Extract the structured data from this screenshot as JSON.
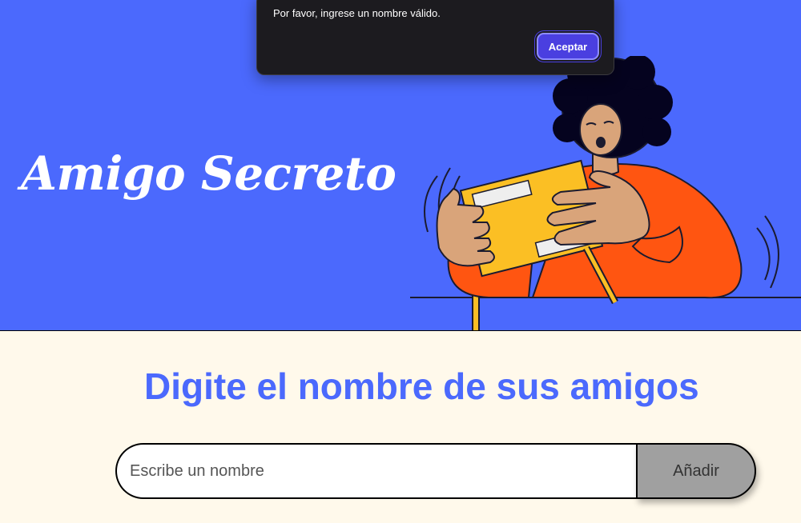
{
  "header": {
    "title": "Amigo Secreto"
  },
  "dialog": {
    "message": "Por favor, ingrese un nombre válido.",
    "ok_label": "Aceptar"
  },
  "main": {
    "section_title": "Digite el nombre de sus amigos",
    "name_input": {
      "placeholder": "Escribe un nombre",
      "value": ""
    },
    "add_button_label": "Añadir"
  },
  "colors": {
    "hero_background": "#4b69fd",
    "page_background": "#fff9eb",
    "title_accent": "#4b69fd",
    "button_background": "#a0a0a0",
    "dialog_background": "#1c1b1f",
    "dialog_button": "#4a3fe0"
  },
  "icons": {
    "hero_illustration": "person-with-gift-box-illustration"
  }
}
